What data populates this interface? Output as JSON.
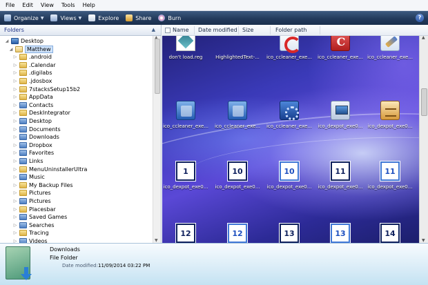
{
  "menu": [
    "File",
    "Edit",
    "View",
    "Tools",
    "Help"
  ],
  "toolbar": {
    "organize": "Organize",
    "views": "Views",
    "explore": "Explore",
    "share": "Share",
    "burn": "Burn",
    "help": "?"
  },
  "folders_pane": {
    "title": "Folders",
    "items": [
      {
        "label": "Desktop",
        "kind": "desktop",
        "depth": 0
      },
      {
        "label": "Matthew",
        "kind": "user",
        "depth": 1,
        "selected": true
      },
      {
        "label": ".android",
        "kind": "folder",
        "depth": 2
      },
      {
        "label": ".Calendar",
        "kind": "folder",
        "depth": 2
      },
      {
        "label": ".digilabs",
        "kind": "folder",
        "depth": 2
      },
      {
        "label": ".jdosbox",
        "kind": "folder",
        "depth": 2
      },
      {
        "label": "7stacksSetup15b2",
        "kind": "folder",
        "depth": 2
      },
      {
        "label": "AppData",
        "kind": "folder",
        "depth": 2
      },
      {
        "label": "Contacts",
        "kind": "special",
        "depth": 2
      },
      {
        "label": "DeskIntegrator",
        "kind": "folder",
        "depth": 2
      },
      {
        "label": "Desktop",
        "kind": "special",
        "depth": 2
      },
      {
        "label": "Documents",
        "kind": "special",
        "depth": 2
      },
      {
        "label": "Downloads",
        "kind": "special",
        "depth": 2
      },
      {
        "label": "Dropbox",
        "kind": "special",
        "depth": 2
      },
      {
        "label": "Favorites",
        "kind": "special",
        "depth": 2
      },
      {
        "label": "Links",
        "kind": "special",
        "depth": 2
      },
      {
        "label": "MenuUninstallerUltra",
        "kind": "folder",
        "depth": 2
      },
      {
        "label": "Music",
        "kind": "special",
        "depth": 2
      },
      {
        "label": "My Backup Files",
        "kind": "folder",
        "depth": 2
      },
      {
        "label": "Pictures",
        "kind": "folder",
        "depth": 2
      },
      {
        "label": "Pictures",
        "kind": "special",
        "depth": 2
      },
      {
        "label": "Placesbar",
        "kind": "folder",
        "depth": 2
      },
      {
        "label": "Saved Games",
        "kind": "special",
        "depth": 2
      },
      {
        "label": "Searches",
        "kind": "special",
        "depth": 2
      },
      {
        "label": "Tracing",
        "kind": "folder",
        "depth": 2
      },
      {
        "label": "Videos",
        "kind": "special",
        "depth": 2
      }
    ]
  },
  "columns": [
    "Name",
    "Date modified",
    "Size",
    "Folder path"
  ],
  "files": [
    {
      "name": "don't load.reg",
      "icon": "reg"
    },
    {
      "name": "HighlightedText-...",
      "icon": "blank"
    },
    {
      "name": "ico_ccleaner_exe...",
      "icon": "ccl"
    },
    {
      "name": "ico_ccleaner_exe...",
      "icon": "ccl2"
    },
    {
      "name": "ico_ccleaner_exe...",
      "icon": "brush"
    },
    {
      "name": "ico_ccleaner_exe...",
      "icon": "blue"
    },
    {
      "name": "ico_ccleaner_exe...",
      "icon": "blue"
    },
    {
      "name": "ico_ccleaner_exe...",
      "icon": "gear"
    },
    {
      "name": "ico_dexpot_exe0...",
      "icon": "mon"
    },
    {
      "name": "ico_dexpot_exe0...",
      "icon": "box"
    },
    {
      "name": "ico_dexpot_exe0...",
      "icon": "num",
      "num": "1"
    },
    {
      "name": "ico_dexpot_exe0...",
      "icon": "num",
      "num": "10"
    },
    {
      "name": "ico_dexpot_exe0...",
      "icon": "num-hi",
      "num": "10"
    },
    {
      "name": "ico_dexpot_exe0...",
      "icon": "num",
      "num": "11"
    },
    {
      "name": "ico_dexpot_exe0...",
      "icon": "num-hi",
      "num": "11"
    },
    {
      "name": "",
      "icon": "num",
      "num": "12"
    },
    {
      "name": "",
      "icon": "num-hi",
      "num": "12"
    },
    {
      "name": "",
      "icon": "num",
      "num": "13"
    },
    {
      "name": "",
      "icon": "num-hi",
      "num": "13"
    },
    {
      "name": "",
      "icon": "num",
      "num": "14"
    }
  ],
  "details": {
    "name": "Downloads",
    "type": "File Folder",
    "date_label": "Date modified:",
    "date_value": "11/09/2014 03:22 PM"
  },
  "icons": {
    "organize": "organize-icon",
    "views": "views-icon",
    "explore": "explore-icon",
    "share": "share-icon",
    "burn": "burn-icon"
  }
}
